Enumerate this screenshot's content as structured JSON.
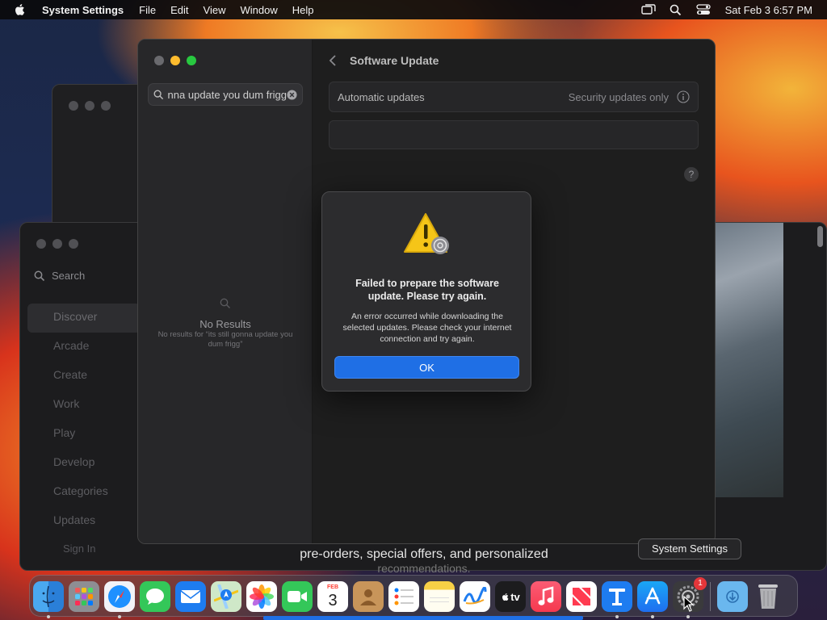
{
  "menubar": {
    "app_name": "System Settings",
    "items": [
      "File",
      "Edit",
      "View",
      "Window",
      "Help"
    ],
    "clock": "Sat Feb 3  6:57 PM",
    "status_icons": [
      "screen-mirroring-icon",
      "spotlight-search-icon",
      "control-center-icon"
    ]
  },
  "app_store": {
    "search_placeholder": "Search",
    "nav": [
      "Discover",
      "Arcade",
      "Create",
      "Work",
      "Play",
      "Develop",
      "Categories",
      "Updates"
    ],
    "sign_in": "Sign In",
    "promo_line1": "pre-orders, special offers, and personalized",
    "promo_line2": "recommendations."
  },
  "settings": {
    "search_value": "its still gonna update you dum frigg",
    "no_results_title": "No Results",
    "no_results_text": "No results for “its still gonna update you dum frigg”",
    "page_title": "Software Update",
    "auto_updates_label": "Automatic updates",
    "auto_updates_value": "Security updates only",
    "help_symbol": "?"
  },
  "dialog": {
    "title": "Failed to prepare the software update. Please try again.",
    "message": "An error occurred while downloading the selected updates. Please check your internet connection and try again.",
    "ok_label": "OK"
  },
  "tooltip": "System Settings",
  "dock": {
    "calendar_month": "FEB",
    "calendar_day": "3",
    "tv_label": "tv",
    "settings_badge": "1",
    "apps": [
      "Finder",
      "Launchpad",
      "Safari",
      "Messages",
      "Mail",
      "Maps",
      "Photos",
      "FaceTime",
      "Calendar",
      "Contacts",
      "Reminders",
      "Notes",
      "Freeform",
      "TV",
      "Music",
      "News",
      "Keynote",
      "App Store",
      "System Settings",
      "Downloads",
      "Trash"
    ]
  }
}
